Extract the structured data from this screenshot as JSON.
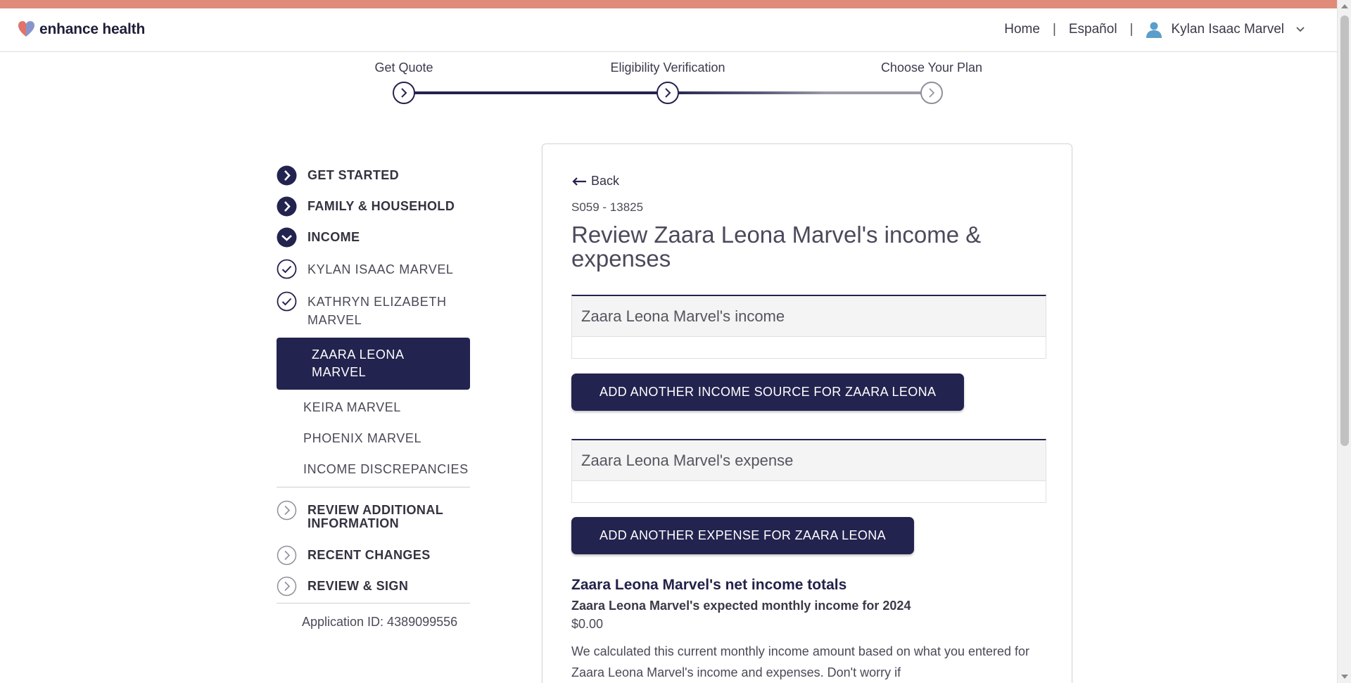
{
  "colors": {
    "accent_stripe": "#e08a7a",
    "navy": "#23234f",
    "logo_red": "#e0746a",
    "logo_blue": "#7c89c4"
  },
  "header": {
    "logo_text": "enhance health",
    "nav": {
      "home": "Home",
      "language": "Español",
      "separator": "|",
      "user_name": "Kylan Isaac Marvel"
    }
  },
  "stepper": {
    "steps": [
      {
        "label": "Get Quote",
        "state": "complete"
      },
      {
        "label": "Eligibility Verification",
        "state": "current"
      },
      {
        "label": "Choose Your Plan",
        "state": "upcoming"
      }
    ]
  },
  "sidebar": {
    "sections": [
      {
        "label": "GET STARTED",
        "icon": "chevron-right-filled-icon"
      },
      {
        "label": "FAMILY & HOUSEHOLD",
        "icon": "chevron-right-filled-icon"
      },
      {
        "label": "INCOME",
        "icon": "chevron-down-filled-icon"
      }
    ],
    "income_members": [
      {
        "label": "KYLAN ISAAC MARVEL",
        "icon": "check-circle-icon"
      },
      {
        "label": "KATHRYN ELIZABETH MARVEL",
        "icon": "check-circle-icon"
      }
    ],
    "active_member": "ZAARA LEONA MARVEL",
    "pending_members": [
      "KEIRA MARVEL",
      "PHOENIX MARVEL",
      "INCOME DISCREPANCIES"
    ],
    "later_sections": [
      {
        "label": "REVIEW ADDITIONAL INFORMATION",
        "icon": "chevron-right-outline-icon"
      },
      {
        "label": "RECENT CHANGES",
        "icon": "chevron-right-outline-icon"
      },
      {
        "label": "REVIEW & SIGN",
        "icon": "chevron-right-outline-icon"
      }
    ],
    "application_id": "Application ID: 4389099556"
  },
  "main": {
    "back_label": "Back",
    "case_id": "S059 - 13825",
    "title": "Review Zaara Leona Marvel's income & expenses",
    "income_section_title": "Zaara Leona Marvel's income",
    "add_income_button": "ADD ANOTHER INCOME SOURCE FOR ZAARA LEONA",
    "expense_section_title": "Zaara Leona Marvel's expense",
    "add_expense_button": "ADD ANOTHER EXPENSE FOR ZAARA LEONA",
    "totals": {
      "title": "Zaara Leona Marvel's net income totals",
      "subtitle": "Zaara Leona Marvel's expected monthly income for 2024",
      "amount": "$0.00",
      "note": "We calculated this current monthly income amount based on what you entered for Zaara Leona Marvel's income and expenses. Don't worry if"
    }
  }
}
